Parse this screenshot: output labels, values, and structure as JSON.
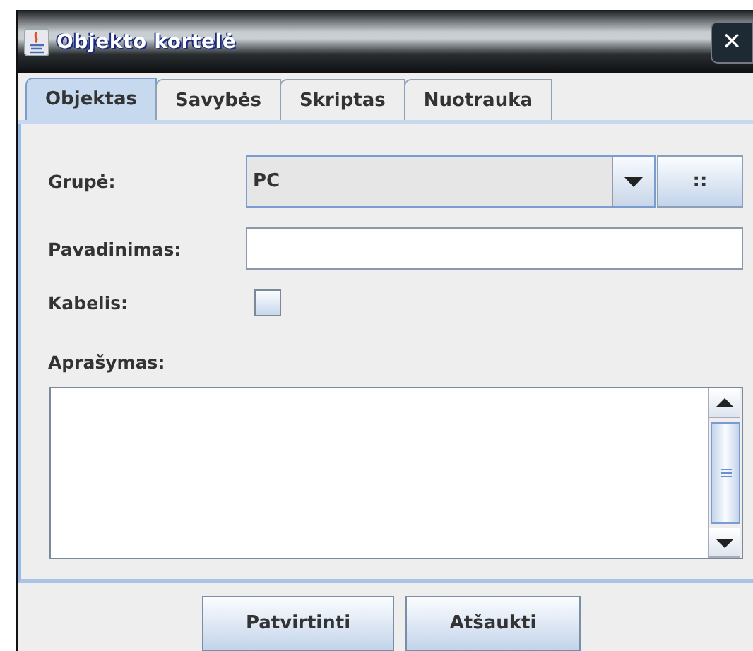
{
  "window": {
    "title": "Objekto kortelė",
    "close": "✕"
  },
  "tabs": [
    {
      "label": "Objektas",
      "selected": true
    },
    {
      "label": "Savybės",
      "selected": false
    },
    {
      "label": "Skriptas",
      "selected": false
    },
    {
      "label": "Nuotrauka",
      "selected": false
    }
  ],
  "form": {
    "group_label": "Grupė:",
    "group_value": "PC",
    "group_button": "::",
    "name_label": "Pavadinimas:",
    "cable_label": "Kabelis:",
    "cable_checked": false,
    "description_label": "Aprašymas:"
  },
  "buttons": [
    "Patvirtinti",
    "Atšaukti"
  ]
}
